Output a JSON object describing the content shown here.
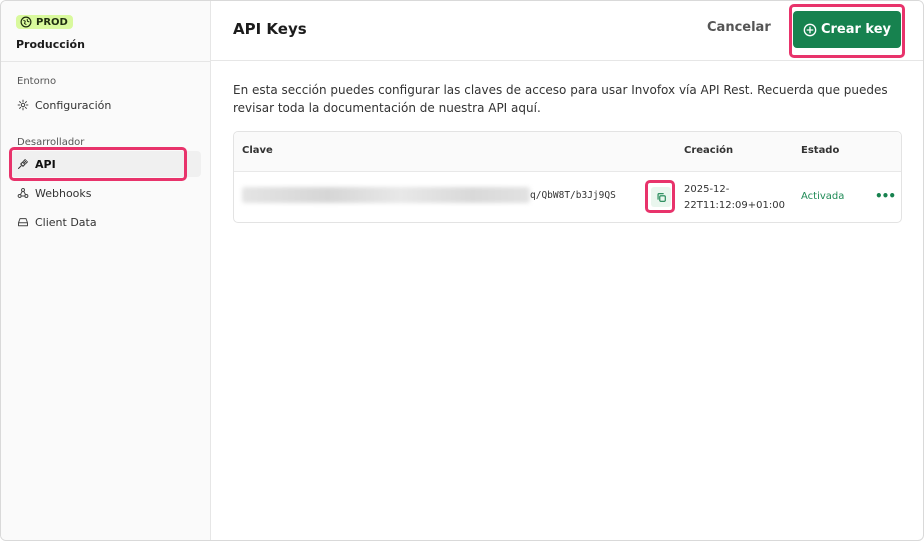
{
  "environment": {
    "badge": "PROD",
    "name": "Producción"
  },
  "sidebar": {
    "sections": [
      {
        "label": "Entorno",
        "items": [
          {
            "label": "Configuración",
            "icon": "gear-icon"
          }
        ]
      },
      {
        "label": "Desarrollador",
        "items": [
          {
            "label": "API",
            "icon": "plug-icon",
            "active": true
          },
          {
            "label": "Webhooks",
            "icon": "webhook-icon"
          },
          {
            "label": "Client Data",
            "icon": "drive-icon"
          }
        ]
      }
    ]
  },
  "header": {
    "title": "API Keys",
    "cancel_label": "Cancelar",
    "create_label": "Crear key"
  },
  "main": {
    "description": "En esta sección puedes configurar las claves de acceso para usar Invofox vía API Rest. Recuerda que puedes revisar toda la documentación de nuestra API aquí.",
    "table": {
      "columns": [
        "Clave",
        "Creación",
        "Estado"
      ],
      "rows": [
        {
          "key_suffix": "q/QbW8T/b3Jj9QS",
          "created_line1": "2025-12-",
          "created_line2": "22T11:12:09+01:00",
          "status": "Activada",
          "more_label": "•••"
        }
      ]
    }
  },
  "colors": {
    "accent": "#17824f",
    "badge_bg": "#d9f99d",
    "highlight": "#e8336b",
    "status_active": "#1f8a56"
  }
}
